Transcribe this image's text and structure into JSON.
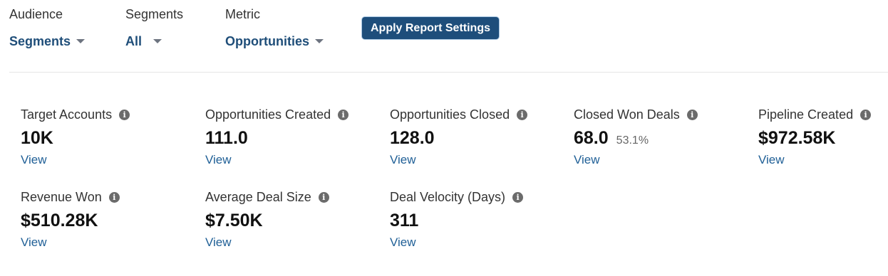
{
  "filters": [
    {
      "label": "Audience",
      "value": "Segments"
    },
    {
      "label": "Segments",
      "value": "All"
    },
    {
      "label": "Metric",
      "value": "Opportunities"
    }
  ],
  "apply_button": "Apply Report Settings",
  "metrics": [
    {
      "title": "Target Accounts",
      "value": "10K",
      "sub": "",
      "link": "View"
    },
    {
      "title": "Opportunities Created",
      "value": "111.0",
      "sub": "",
      "link": "View"
    },
    {
      "title": "Opportunities Closed",
      "value": "128.0",
      "sub": "",
      "link": "View"
    },
    {
      "title": "Closed Won Deals",
      "value": "68.0",
      "sub": "53.1%",
      "link": "View"
    },
    {
      "title": "Pipeline Created",
      "value": "$972.58K",
      "sub": "",
      "link": "View"
    },
    {
      "title": "Revenue Won",
      "value": "$510.28K",
      "sub": "",
      "link": "View"
    },
    {
      "title": "Average Deal Size",
      "value": "$7.50K",
      "sub": "",
      "link": "View"
    },
    {
      "title": "Deal Velocity (Days)",
      "value": "311",
      "sub": "",
      "link": "View"
    }
  ],
  "colors": {
    "accent": "#1e4e7b",
    "link": "#1f5f96",
    "info_icon": "#6b6b6b"
  }
}
